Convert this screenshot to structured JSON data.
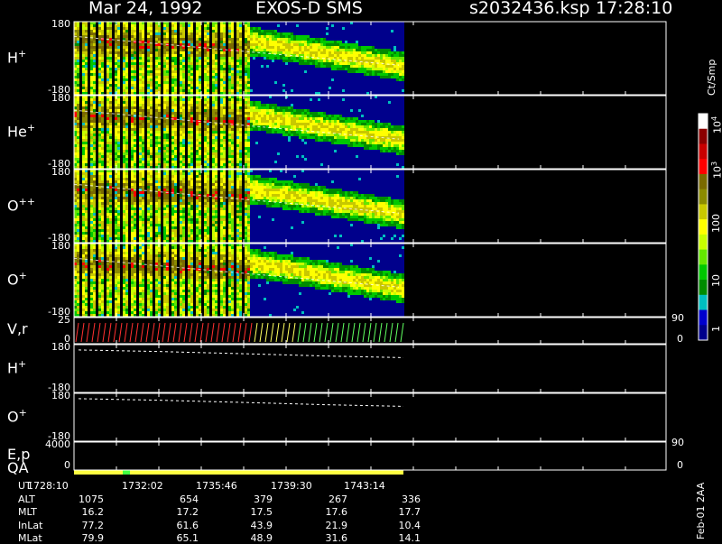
{
  "header": {
    "date": "Mar 24, 1992",
    "instrument": "EXOS-D SMS",
    "file": "s2032436.ksp",
    "time": "17:28:10"
  },
  "panels": [
    {
      "label": "H",
      "sup": "+",
      "top": "180",
      "bot": "-180"
    },
    {
      "label": "He",
      "sup": "+",
      "top": "180",
      "bot": "-180"
    },
    {
      "label": "O",
      "sup": "++",
      "top": "180",
      "bot": "-180"
    },
    {
      "label": "O",
      "sup": "+",
      "top": "180",
      "bot": "-180"
    },
    {
      "label": "V,r",
      "sup": "",
      "top": "25",
      "bot": "0",
      "rtop": "90",
      "rbot": "0"
    },
    {
      "label": "H",
      "sup": "+",
      "top": "180",
      "bot": "-180"
    },
    {
      "label": "O",
      "sup": "+",
      "top": "180",
      "bot": "-180"
    },
    {
      "label": "E,p",
      "sup": "",
      "top": "4000",
      "bot": "0",
      "rtop": "90",
      "rbot": "0"
    }
  ],
  "qa_label": "QA",
  "colorbar": {
    "unit": "Ct/Smp",
    "ticks": [
      "1",
      "10",
      "100",
      "10",
      "10"
    ],
    "tick_exps": [
      "",
      "",
      "",
      "3",
      "4"
    ],
    "colors": [
      "#00008b",
      "#0000cd",
      "#00bfbf",
      "#008b00",
      "#00c800",
      "#64e600",
      "#c8ff00",
      "#ffff00",
      "#c8c800",
      "#8b8b00",
      "#7a6a00",
      "#ff0000",
      "#c80000",
      "#8b0000",
      "#ffffff"
    ]
  },
  "table": {
    "rows": [
      {
        "name": "UT",
        "values": [
          "1728:10",
          "1732:02",
          "1735:46",
          "1739:30",
          "1743:14"
        ]
      },
      {
        "name": "ALT",
        "values": [
          "1075",
          "654",
          "379",
          "267",
          "336"
        ]
      },
      {
        "name": "MLT",
        "values": [
          "16.2",
          "17.2",
          "17.5",
          "17.6",
          "17.7"
        ]
      },
      {
        "name": "InLat",
        "values": [
          "77.2",
          "61.6",
          "43.9",
          "21.9",
          "10.4"
        ]
      },
      {
        "name": "MLat",
        "values": [
          "79.9",
          "65.1",
          "48.9",
          "31.6",
          "14.1"
        ]
      }
    ]
  },
  "footer_note": "Feb-01 2AA",
  "chart_data": {
    "type": "heatmap",
    "title": "Mar 24, 1992   EXOS-D SMS",
    "x_ticks": [
      "1728:10",
      "1732:02",
      "1735:46",
      "1739:30",
      "1743:14"
    ],
    "series": [
      {
        "name": "H+ pitch-angle spectrogram",
        "ylim": [
          -180,
          180
        ]
      },
      {
        "name": "He+ pitch-angle spectrogram",
        "ylim": [
          -180,
          180
        ]
      },
      {
        "name": "O++ pitch-angle spectrogram",
        "ylim": [
          -180,
          180
        ]
      },
      {
        "name": "O+ pitch-angle spectrogram",
        "ylim": [
          -180,
          180
        ]
      },
      {
        "name": "V,r",
        "ylim": [
          0,
          25
        ],
        "rlim": [
          0,
          90
        ]
      },
      {
        "name": "H+ line",
        "ylim": [
          -180,
          180
        ],
        "values": [
          140,
          128,
          112,
          95,
          82
        ]
      },
      {
        "name": "O+ line",
        "ylim": [
          -180,
          180
        ],
        "values": [
          140,
          128,
          112,
          95,
          82
        ]
      },
      {
        "name": "E,p",
        "ylim": [
          0,
          4000
        ],
        "rlim": [
          0,
          90
        ]
      }
    ]
  }
}
